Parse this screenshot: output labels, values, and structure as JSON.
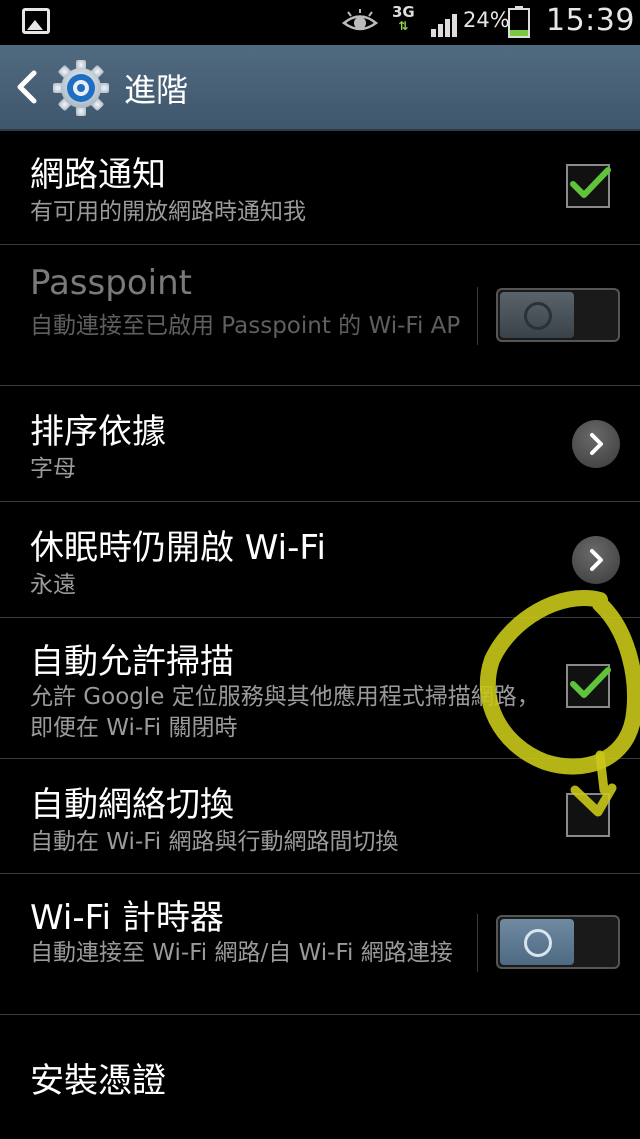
{
  "status_bar": {
    "network": "3G",
    "battery_percent": "24%",
    "battery_level": 0.24,
    "time": "15:39",
    "icons": [
      "gallery-icon",
      "eye-icon",
      "data-arrows-icon",
      "signal-icon",
      "battery-icon"
    ]
  },
  "action_bar": {
    "title": "進階",
    "icons": [
      "back-icon",
      "settings-gear-icon"
    ]
  },
  "settings": [
    {
      "title": "網路通知",
      "subtitle": "有可用的開放網路時通知我",
      "control": "checkbox",
      "checked": true,
      "enabled": true
    },
    {
      "title": "Passpoint",
      "subtitle": "自動連接至已啟用 Passpoint 的 Wi-Fi AP",
      "control": "toggle",
      "on": false,
      "enabled": false
    },
    {
      "title": "排序依據",
      "subtitle": "字母",
      "control": "chevron",
      "enabled": true
    },
    {
      "title": "休眠時仍開啟 Wi-Fi",
      "subtitle": "永遠",
      "control": "chevron",
      "enabled": true
    },
    {
      "title": "自動允許掃描",
      "subtitle": "允許 Google 定位服務與其他應用程式掃描網路，即便在 Wi-Fi 關閉時",
      "control": "checkbox",
      "checked": true,
      "enabled": true
    },
    {
      "title": "自動網絡切換",
      "subtitle": "自動在 Wi-Fi 網路與行動網路間切換",
      "control": "checkbox",
      "checked": false,
      "enabled": true
    },
    {
      "title": "Wi-Fi 計時器",
      "subtitle": "自動連接至 Wi-Fi 網路/自 Wi-Fi 網路連接",
      "control": "toggle",
      "on": false,
      "enabled": true
    },
    {
      "title": "安裝憑證",
      "subtitle": "",
      "control": "none",
      "enabled": true
    }
  ],
  "colors": {
    "background": "#000000",
    "action_bar": "#4a6378",
    "check_green": "#5fc43a",
    "annotation_yellow": "#cfcf1f"
  }
}
